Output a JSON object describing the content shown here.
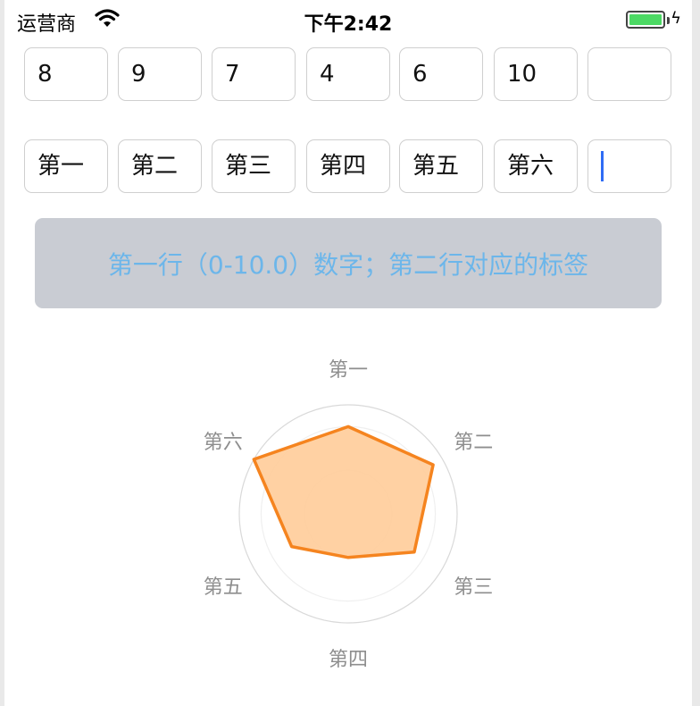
{
  "status_bar": {
    "carrier": "运营商",
    "time": "下午2:42",
    "wifi_icon": "wifi-icon",
    "battery_icon": "battery-icon",
    "charging_icon": "charging-bolt-icon",
    "battery_color": "#4cd964"
  },
  "inputs": {
    "values": [
      "8",
      "9",
      "7",
      "4",
      "6",
      "10",
      ""
    ],
    "labels": [
      "第一",
      "第二",
      "第三",
      "第四",
      "第五",
      "第六",
      ""
    ]
  },
  "hint": {
    "text": "第一行（0-10.0）数字；第二行对应的标签"
  },
  "colors": {
    "hint_text": "#6cb6ea",
    "hint_background": "#c9ccd3",
    "radar_fill": "#ffcc99",
    "radar_stroke": "#f5841f",
    "caret": "#2f6cf5"
  },
  "chart_data": {
    "type": "radar",
    "categories": [
      "第一",
      "第二",
      "第三",
      "第四",
      "第五",
      "第六"
    ],
    "values": [
      8,
      9,
      7,
      4,
      6,
      10
    ],
    "max": 10
  }
}
